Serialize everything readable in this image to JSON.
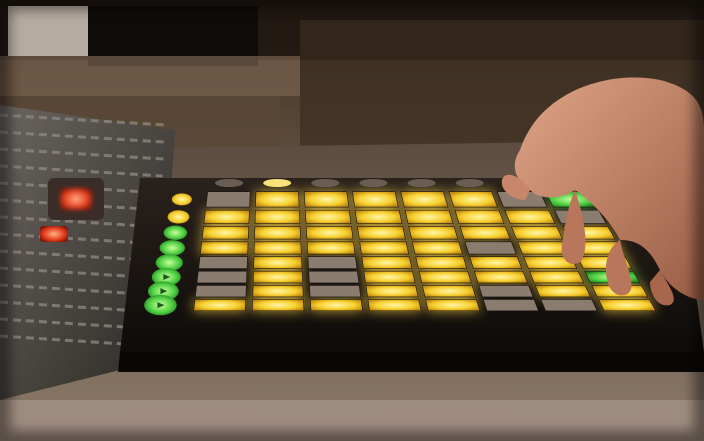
{
  "scene": {
    "description_hidden": "",
    "palette": {
      "background_dark": "#1c140d",
      "wall_warm": "#6b5540",
      "table_surface": "#7a6656",
      "device_body": "#161210",
      "pad_off": "#8a7d70",
      "pad_yellow": "#f4c62a",
      "pad_yellow_glow": "#ffd84a",
      "pad_green": "#46c43c",
      "pad_red": "#e0321e",
      "skin": "#c8876a"
    }
  },
  "launchpad": {
    "grid_columns": 8,
    "grid_rows": 8,
    "pad_states": [
      [
        "off",
        "yellow",
        "yellow",
        "yellow",
        "yellow",
        "yellow",
        "off",
        "green"
      ],
      [
        "yellow",
        "yellow",
        "yellow",
        "yellow",
        "yellow",
        "yellow",
        "yellow",
        "off"
      ],
      [
        "yellow",
        "yellow",
        "yellow",
        "yellow",
        "yellow",
        "yellow",
        "yellow",
        "yellow"
      ],
      [
        "yellow",
        "yellow",
        "yellow",
        "yellow",
        "yellow",
        "off",
        "yellow",
        "yellow"
      ],
      [
        "off",
        "yellow",
        "off",
        "yellow",
        "yellow",
        "yellow",
        "yellow",
        "yellow"
      ],
      [
        "off",
        "yellow",
        "off",
        "yellow",
        "yellow",
        "yellow",
        "yellow",
        "green"
      ],
      [
        "off",
        "yellow",
        "off",
        "yellow",
        "yellow",
        "off",
        "yellow",
        "yellow"
      ],
      [
        "yellow",
        "yellow",
        "yellow",
        "yellow",
        "yellow",
        "off",
        "off",
        "yellow"
      ]
    ],
    "side_buttons": [
      "yellow",
      "yellow",
      "green",
      "green",
      "green",
      "green",
      "green",
      "green"
    ],
    "top_buttons": [
      "off",
      "off",
      "off",
      "off",
      "off",
      "off",
      "off",
      "off"
    ]
  }
}
